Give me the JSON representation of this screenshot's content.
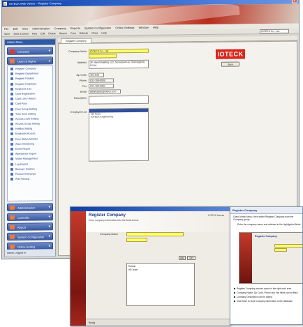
{
  "window": {
    "title": "IOTECK Web Viewer – Register Company",
    "close_glyph": "✕"
  },
  "menubar": [
    "File",
    "Edit",
    "View",
    "Administration",
    "Company",
    "Reports",
    "System Configuration",
    "Online Settings",
    "Window",
    "Help"
  ],
  "toolbar": {
    "items": [
      "Save",
      "Save & Close",
      "New",
      "Edit",
      "Delete",
      "Search",
      "Print",
      "Refresh",
      "Close",
      "Help"
    ],
    "combo_value": "IOTECK Co., Ltd."
  },
  "sidebar": {
    "header": "Admin Menu",
    "top_group": "Company",
    "second_group": "Users & Rights",
    "items": [
      "Register Company",
      "Register Department",
      "Register Position",
      "Register Employee",
      "Employee List",
      "Card Registration",
      "Card Lost / Return",
      "Card Pass",
      "Door Group Setting",
      "Time Zone Setting",
      "Access Level Setting",
      "Access Group Setting",
      "Holiday Setting",
      "Employee Access",
      "Door Status Monitor",
      "Alarm Monitoring",
      "Event Report",
      "Attendance Report",
      "Visitor Management",
      "Log Report",
      "Backup / Restore",
      "Password Change",
      "Auto Backup"
    ],
    "groups_bottom": [
      "Administration",
      "Controller",
      "Report",
      "System Configuration",
      "Online Setting"
    ],
    "status": "Admin Logged In"
  },
  "tab": {
    "label": "Register Company"
  },
  "form": {
    "company_name_label": "Company Name",
    "company_name_value": "IOTECK Co., Ltd.",
    "company_name_sub_value": "",
    "address_label": "Address",
    "address_value": "3F, Hanil Building 123, Seongnam-si, Gyeonggi-do, Korea",
    "zipcode_label": "Zip Code",
    "zipcode_value": "463-838",
    "phone_label": "Phone",
    "phone_value": "031-789-0000",
    "fax_label": "Fax",
    "fax_value": "031-789-0001",
    "email_label": "Email",
    "email_value": "webmaster@ioteck.com",
    "description_label": "Description",
    "description_value": "",
    "employee_list_label": "Employee List",
    "employee_list_items": [
      "",
      "HR Team",
      "IOTECK Engineering"
    ],
    "save_button": "Save",
    "logo_text": "IOTECK"
  },
  "overlay1": {
    "title": "Register Company",
    "subtitle": "Enter company information into the fields below.",
    "mini_note": "IOTECK Access",
    "company_label": "Company Name",
    "list_items": [
      "Default",
      "HR Team"
    ],
    "btn_add": "Add",
    "btn_del": "Del",
    "footer_status": "Ready"
  },
  "overlay2": {
    "header": "Register Company",
    "intro": "Open Admin Menu, then select Register Company from the Company group.",
    "step": "Enter the company name and address in the highlighted fields.",
    "thumb_title": "Register Company",
    "bullets": [
      "Register Company window opens in the right work area.",
      "Company Name, Zip Code, Phone and Fax fields can be filled.",
      "Company Description can be added.",
      "Click Save to store company information to the database."
    ]
  }
}
